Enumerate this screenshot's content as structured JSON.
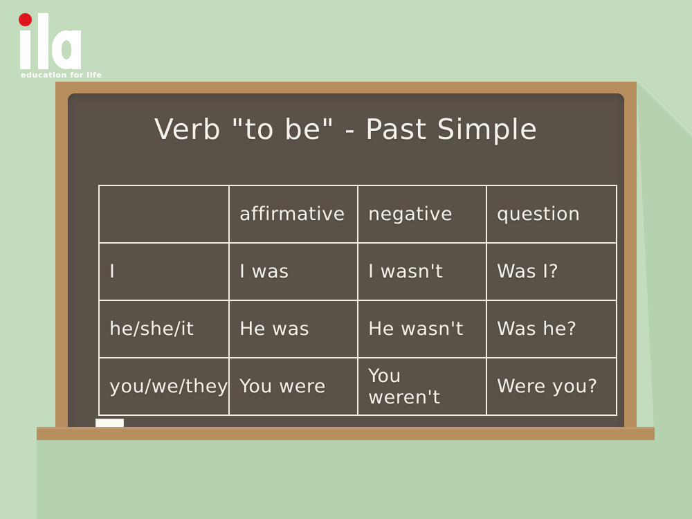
{
  "branding": {
    "logo_text": "ila",
    "tagline": "education for life",
    "dot_color": "#e0161e",
    "text_color": "#ffffff"
  },
  "colors": {
    "background": "#c3dcbd",
    "shadow": "#b4d2ad",
    "board_frame": "#b78e5e",
    "board_surface": "#5a5148",
    "chalk": "#fbfbf6",
    "chalk_text": "#f4f2ec"
  },
  "blackboard": {
    "title": "Verb \"to be\" - Past Simple",
    "table": {
      "headers": [
        "",
        "affirmative",
        "negative",
        "question"
      ],
      "rows": [
        {
          "person": "I",
          "affirmative": "I was",
          "negative": "I wasn't",
          "question": "Was I?"
        },
        {
          "person": "he/she/it",
          "affirmative": "He was",
          "negative": "He wasn't",
          "question": "Was he?"
        },
        {
          "person": "you/we/they",
          "affirmative": "You were",
          "negative": "You weren't",
          "question": "Were you?"
        }
      ]
    }
  },
  "chalk_ledge": {
    "chalk_label": "chalk"
  }
}
